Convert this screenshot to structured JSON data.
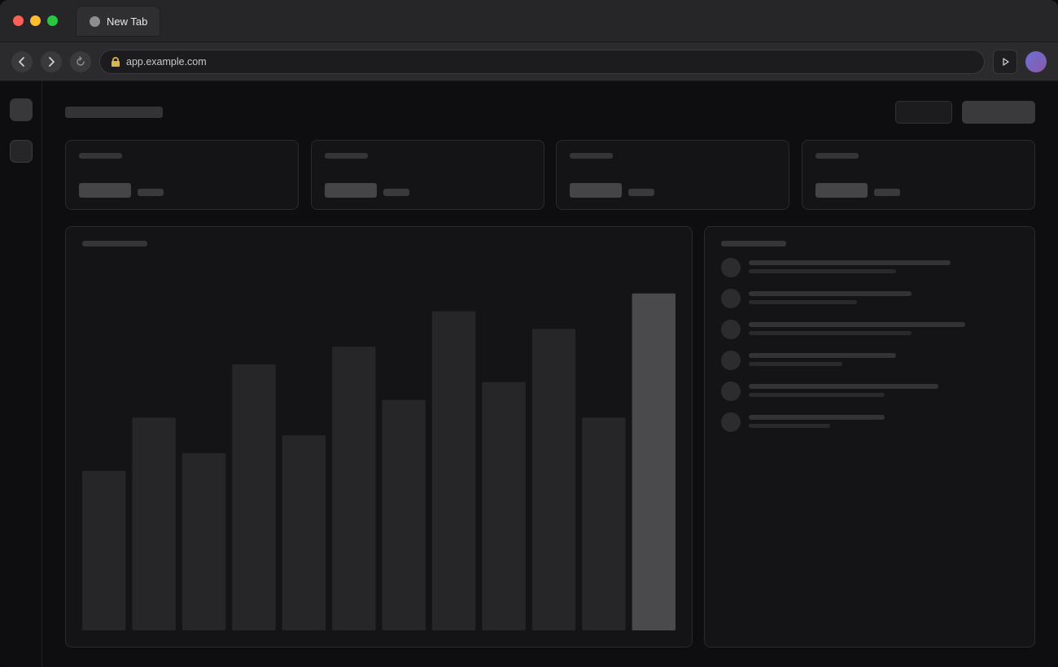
{
  "tab": {
    "title": "New Tab"
  },
  "address_bar": {
    "url": "app.example.com"
  },
  "icons": {
    "back": "chevron-left-icon",
    "forward": "chevron-right-icon",
    "reload": "reload-icon",
    "lock": "lock-icon",
    "extension": "play-icon"
  },
  "colors": {
    "close": "#fe5f57",
    "minimize": "#febc2e",
    "maximize": "#28c840",
    "bar": "#262628",
    "bar_highlight": "#4a4a4c"
  },
  "chart_data": {
    "type": "bar",
    "values": [
      36,
      48,
      40,
      60,
      44,
      64,
      52,
      72,
      56,
      68,
      48,
      76
    ],
    "highlight_index": 11
  },
  "activity": {
    "items": [
      {
        "line1": 0.67,
        "line2": 0.49
      },
      {
        "line1": 0.54,
        "line2": 0.36
      },
      {
        "line1": 0.72,
        "line2": 0.54
      },
      {
        "line1": 0.49,
        "line2": 0.31
      },
      {
        "line1": 0.63,
        "line2": 0.45
      },
      {
        "line1": 0.45,
        "line2": 0.27
      }
    ]
  }
}
